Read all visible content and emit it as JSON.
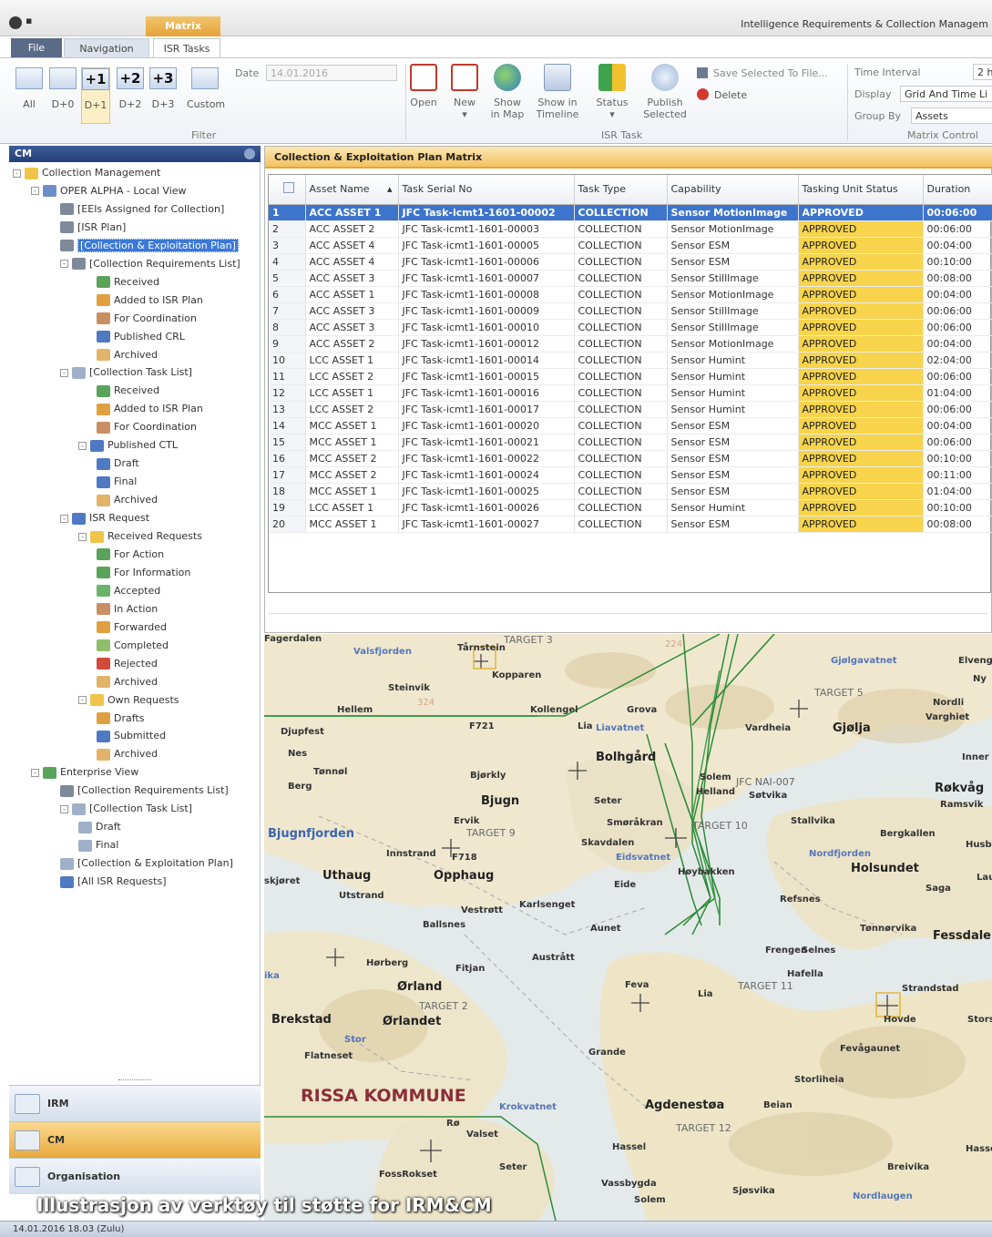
{
  "window": {
    "quick_access": "▪",
    "context_tab": "Matrix",
    "app_title": "Intelligence Requirements & Collection Managem"
  },
  "ribbon": {
    "tabs": [
      {
        "label": "File"
      },
      {
        "label": "Navigation"
      },
      {
        "label": "ISR Tasks"
      }
    ],
    "filter": {
      "group_label": "Filter",
      "buttons": [
        {
          "icon": "",
          "label": "All"
        },
        {
          "icon": "",
          "label": "D+0"
        },
        {
          "icon": "+1",
          "label": "D+1"
        },
        {
          "icon": "+2",
          "label": "D+2"
        },
        {
          "icon": "+3",
          "label": "D+3"
        },
        {
          "icon": "",
          "label": "Custom"
        }
      ],
      "date_label": "Date",
      "date_value": "14.01.2016"
    },
    "isr_task": {
      "group_label": "ISR Task",
      "buttons": [
        {
          "label": "Open",
          "label2": ""
        },
        {
          "label": "New",
          "label2": "▾"
        },
        {
          "label": "Show",
          "label2": "in Map"
        },
        {
          "label": "Show in",
          "label2": "Timeline"
        },
        {
          "label": "Status",
          "label2": "▾"
        },
        {
          "label": "Publish",
          "label2": "Selected"
        }
      ],
      "save_label": "Save Selected To File...",
      "delete_label": "Delete"
    },
    "matrix_control": {
      "group_label": "Matrix Control",
      "time_interval_label": "Time Interval",
      "time_interval_value": "2 h",
      "display_label": "Display",
      "display_value": "Grid And Time Li",
      "group_by_label": "Group By",
      "group_by_value": "Assets"
    }
  },
  "left_panel": {
    "title": "CM",
    "tree": [
      {
        "label": "Collection Management",
        "exp": "-",
        "color": "#f0c34a"
      },
      {
        "label": "OPER ALPHA - Local View",
        "exp": "-",
        "color": "#6d8fc9"
      },
      {
        "label": "[EEIs Assigned for Collection]",
        "exp": "",
        "color": "#7e8a9a"
      },
      {
        "label": "[ISR Plan]",
        "exp": "",
        "color": "#7e8a9a"
      },
      {
        "label": "[Collection & Exploitation Plan]",
        "exp": "",
        "color": "#7e8a9a"
      },
      {
        "label": "[Collection Requirements List]",
        "exp": "-",
        "color": "#7e8a9a"
      },
      {
        "label": "Received",
        "exp": "",
        "color": "#5aa35a"
      },
      {
        "label": "Added to ISR Plan",
        "exp": "",
        "color": "#e0a040"
      },
      {
        "label": "For Coordination",
        "exp": "",
        "color": "#c98f63"
      },
      {
        "label": "Published CRL",
        "exp": "",
        "color": "#4f79c2"
      },
      {
        "label": "Archived",
        "exp": "",
        "color": "#e3b36a"
      },
      {
        "label": "[Collection Task List]",
        "exp": "-",
        "color": "#9fb0c8"
      },
      {
        "label": "Received",
        "exp": "",
        "color": "#5aa35a"
      },
      {
        "label": "Added to ISR Plan",
        "exp": "",
        "color": "#e0a040"
      },
      {
        "label": "For Coordination",
        "exp": "",
        "color": "#c98f63"
      },
      {
        "label": "Published CTL",
        "exp": "-",
        "color": "#4f79c2"
      },
      {
        "label": "Draft",
        "exp": "",
        "color": "#4f79c2"
      },
      {
        "label": "Final",
        "exp": "",
        "color": "#4f79c2"
      },
      {
        "label": "Archived",
        "exp": "",
        "color": "#e3b36a"
      },
      {
        "label": "ISR Request",
        "exp": "-",
        "color": "#4f79c2"
      },
      {
        "label": "Received Requests",
        "exp": "-",
        "color": "#f0c34a"
      },
      {
        "label": "For Action",
        "exp": "",
        "color": "#5aa35a"
      },
      {
        "label": "For Information",
        "exp": "",
        "color": "#5aa35a"
      },
      {
        "label": "Accepted",
        "exp": "",
        "color": "#6bb36b"
      },
      {
        "label": "In Action",
        "exp": "",
        "color": "#c98f63"
      },
      {
        "label": "Forwarded",
        "exp": "",
        "color": "#e0a040"
      },
      {
        "label": "Completed",
        "exp": "",
        "color": "#8fbf6a"
      },
      {
        "label": "Rejected",
        "exp": "",
        "color": "#d24a3a"
      },
      {
        "label": "Archived",
        "exp": "",
        "color": "#e3b36a"
      },
      {
        "label": "Own Requests",
        "exp": "-",
        "color": "#f0c34a"
      },
      {
        "label": "Drafts",
        "exp": "",
        "color": "#e0a040"
      },
      {
        "label": "Submitted",
        "exp": "",
        "color": "#4f79c2"
      },
      {
        "label": "Archived",
        "exp": "",
        "color": "#e3b36a"
      },
      {
        "label": "Enterprise View",
        "exp": "-",
        "color": "#5aa35a"
      },
      {
        "label": "[Collection Requirements List]",
        "exp": "",
        "color": "#7e8a9a"
      },
      {
        "label": "[Collection Task List]",
        "exp": "-",
        "color": "#9fb0c8"
      },
      {
        "label": "Draft",
        "exp": "",
        "color": "#9fb0c8"
      },
      {
        "label": "Final",
        "exp": "",
        "color": "#9fb0c8"
      },
      {
        "label": "[Collection & Exploitation Plan]",
        "exp": "",
        "color": "#9fb0c8"
      },
      {
        "label": "[All ISR Requests]",
        "exp": "",
        "color": "#4f79c2"
      }
    ],
    "nav_buttons": [
      {
        "label": "IRM"
      },
      {
        "label": "CM"
      },
      {
        "label": "Organisation"
      }
    ]
  },
  "matrix": {
    "title": "Collection & Exploitation Plan Matrix",
    "columns": [
      "",
      "Asset Name",
      "Task Serial No",
      "Task Type",
      "Capability",
      "Tasking Unit Status",
      "Duration"
    ],
    "sort_glyph": "▴",
    "rows": [
      [
        "1",
        "ACC ASSET 1",
        "JFC Task-icmt1-1601-00002",
        "COLLECTION",
        "Sensor MotionImage",
        "APPROVED",
        "00:06:00"
      ],
      [
        "2",
        "ACC ASSET 2",
        "JFC Task-icmt1-1601-00003",
        "COLLECTION",
        "Sensor MotionImage",
        "APPROVED",
        "00:06:00"
      ],
      [
        "3",
        "ACC ASSET 4",
        "JFC Task-icmt1-1601-00005",
        "COLLECTION",
        "Sensor ESM",
        "APPROVED",
        "00:04:00"
      ],
      [
        "4",
        "ACC ASSET 4",
        "JFC Task-icmt1-1601-00006",
        "COLLECTION",
        "Sensor ESM",
        "APPROVED",
        "00:10:00"
      ],
      [
        "5",
        "ACC ASSET 3",
        "JFC Task-icmt1-1601-00007",
        "COLLECTION",
        "Sensor StillImage",
        "APPROVED",
        "00:08:00"
      ],
      [
        "6",
        "ACC ASSET 1",
        "JFC Task-icmt1-1601-00008",
        "COLLECTION",
        "Sensor MotionImage",
        "APPROVED",
        "00:04:00"
      ],
      [
        "7",
        "ACC ASSET 3",
        "JFC Task-icmt1-1601-00009",
        "COLLECTION",
        "Sensor StillImage",
        "APPROVED",
        "00:06:00"
      ],
      [
        "8",
        "ACC ASSET 3",
        "JFC Task-icmt1-1601-00010",
        "COLLECTION",
        "Sensor StillImage",
        "APPROVED",
        "00:06:00"
      ],
      [
        "9",
        "ACC ASSET 2",
        "JFC Task-icmt1-1601-00012",
        "COLLECTION",
        "Sensor MotionImage",
        "APPROVED",
        "00:04:00"
      ],
      [
        "10",
        "LCC ASSET 1",
        "JFC Task-icmt1-1601-00014",
        "COLLECTION",
        "Sensor Humint",
        "APPROVED",
        "02:04:00"
      ],
      [
        "11",
        "LCC ASSET 2",
        "JFC Task-icmt1-1601-00015",
        "COLLECTION",
        "Sensor Humint",
        "APPROVED",
        "00:06:00"
      ],
      [
        "12",
        "LCC ASSET 1",
        "JFC Task-icmt1-1601-00016",
        "COLLECTION",
        "Sensor Humint",
        "APPROVED",
        "01:04:00"
      ],
      [
        "13",
        "LCC ASSET 2",
        "JFC Task-icmt1-1601-00017",
        "COLLECTION",
        "Sensor Humint",
        "APPROVED",
        "00:06:00"
      ],
      [
        "14",
        "MCC ASSET 1",
        "JFC Task-icmt1-1601-00020",
        "COLLECTION",
        "Sensor ESM",
        "APPROVED",
        "00:04:00"
      ],
      [
        "15",
        "MCC ASSET 1",
        "JFC Task-icmt1-1601-00021",
        "COLLECTION",
        "Sensor ESM",
        "APPROVED",
        "00:06:00"
      ],
      [
        "16",
        "MCC ASSET 2",
        "JFC Task-icmt1-1601-00022",
        "COLLECTION",
        "Sensor ESM",
        "APPROVED",
        "00:10:00"
      ],
      [
        "17",
        "MCC ASSET 2",
        "JFC Task-icmt1-1601-00024",
        "COLLECTION",
        "Sensor ESM",
        "APPROVED",
        "00:11:00"
      ],
      [
        "18",
        "MCC ASSET 1",
        "JFC Task-icmt1-1601-00025",
        "COLLECTION",
        "Sensor ESM",
        "APPROVED",
        "01:04:00"
      ],
      [
        "19",
        "LCC ASSET 1",
        "JFC Task-icmt1-1601-00026",
        "COLLECTION",
        "Sensor Humint",
        "APPROVED",
        "00:10:00"
      ],
      [
        "20",
        "MCC ASSET 1",
        "JFC Task-icmt1-1601-00027",
        "COLLECTION",
        "Sensor ESM",
        "APPROVED",
        "00:08:00"
      ]
    ]
  },
  "map": {
    "labels": [
      {
        "text": "Valsfjorden",
        "cls": "blue sm"
      },
      {
        "text": "Tårnstein",
        "cls": "sm"
      },
      {
        "text": "TARGET 3",
        "cls": "target"
      },
      {
        "text": "Kopparen",
        "cls": "sm"
      },
      {
        "text": "224",
        "cls": "num"
      },
      {
        "text": "Gjølgavatnet",
        "cls": "blue sm"
      },
      {
        "text": "Elveng",
        "cls": "sm"
      },
      {
        "text": "Ny",
        "cls": "sm"
      },
      {
        "text": "Steinvik",
        "cls": "sm"
      },
      {
        "text": "324",
        "cls": "num"
      },
      {
        "text": "Hellem",
        "cls": "sm"
      },
      {
        "text": "Kollengel",
        "cls": "sm"
      },
      {
        "text": "Grova",
        "cls": "sm"
      },
      {
        "text": "TARGET 5",
        "cls": "target"
      },
      {
        "text": "Nordli",
        "cls": "sm"
      },
      {
        "text": "Varghiet",
        "cls": "sm"
      },
      {
        "text": "Djupfest",
        "cls": "sm"
      },
      {
        "text": "F721",
        "cls": "sm"
      },
      {
        "text": "Lia",
        "cls": "sm"
      },
      {
        "text": "Liavatnet",
        "cls": "blue sm"
      },
      {
        "text": "Vardheia",
        "cls": "sm"
      },
      {
        "text": "Gjølja",
        "cls": "big"
      },
      {
        "text": "Nes",
        "cls": "sm"
      },
      {
        "text": "Bolhgård",
        "cls": "big"
      },
      {
        "text": "Inner",
        "cls": "sm"
      },
      {
        "text": "Tønnøl",
        "cls": "sm"
      },
      {
        "text": "Bjørkly",
        "cls": "sm"
      },
      {
        "text": "Solem",
        "cls": "sm"
      },
      {
        "text": "Helland",
        "cls": "sm"
      },
      {
        "text": "JFC NAI-007",
        "cls": "nai"
      },
      {
        "text": "Søtvika",
        "cls": "sm"
      },
      {
        "text": "Berg",
        "cls": "sm"
      },
      {
        "text": "Bjugn",
        "cls": "big"
      },
      {
        "text": "Seter",
        "cls": "sm"
      },
      {
        "text": "Røkvåg",
        "cls": "big"
      },
      {
        "text": "Ramsvik",
        "cls": "sm"
      },
      {
        "text": "Ervik",
        "cls": "sm"
      },
      {
        "text": "Smøråkran",
        "cls": "sm"
      },
      {
        "text": "TARGET 10",
        "cls": "target"
      },
      {
        "text": "Stallvika",
        "cls": "sm"
      },
      {
        "text": "Bjugnfjorden",
        "cls": "water"
      },
      {
        "text": "TARGET 9",
        "cls": "target"
      },
      {
        "text": "Skavdalen",
        "cls": "sm"
      },
      {
        "text": "Bergkallen",
        "cls": "sm"
      },
      {
        "text": "Husb",
        "cls": "sm"
      },
      {
        "text": "Innstrand",
        "cls": "sm"
      },
      {
        "text": "F718",
        "cls": "sm"
      },
      {
        "text": "Eidsvatnet",
        "cls": "blue sm"
      },
      {
        "text": "Nordfjorden",
        "cls": "blue sm"
      },
      {
        "text": "Holsundet",
        "cls": "big"
      },
      {
        "text": "Lauvlin",
        "cls": "sm"
      },
      {
        "text": "skjøret",
        "cls": "sm"
      },
      {
        "text": "Uthaug",
        "cls": "big"
      },
      {
        "text": "Opphaug",
        "cls": "big"
      },
      {
        "text": "Høybakken",
        "cls": "sm"
      },
      {
        "text": "Eide",
        "cls": "sm"
      },
      {
        "text": "Saga",
        "cls": "sm"
      },
      {
        "text": "Utstrand",
        "cls": "sm"
      },
      {
        "text": "Refsnes",
        "cls": "sm"
      },
      {
        "text": "Karlsenget",
        "cls": "sm"
      },
      {
        "text": "Vestrøtt",
        "cls": "sm"
      },
      {
        "text": "Ballsnes",
        "cls": "sm"
      },
      {
        "text": "Aunet",
        "cls": "sm"
      },
      {
        "text": "Tønnørvika",
        "cls": "sm"
      },
      {
        "text": "Fessdalen",
        "cls": "big"
      },
      {
        "text": "Frengen",
        "cls": "sm"
      },
      {
        "text": "Selnes",
        "cls": "sm"
      },
      {
        "text": "Austrått",
        "cls": "sm"
      },
      {
        "text": "Hørberg",
        "cls": "sm"
      },
      {
        "text": "Fitjan",
        "cls": "sm"
      },
      {
        "text": "Hafella",
        "cls": "sm"
      },
      {
        "text": "ika",
        "cls": "blue sm"
      },
      {
        "text": "Ørland",
        "cls": "big"
      },
      {
        "text": "Feva",
        "cls": "sm"
      },
      {
        "text": "TARGET 11",
        "cls": "target"
      },
      {
        "text": "Lia",
        "cls": "sm"
      },
      {
        "text": "Strandstad",
        "cls": "sm"
      },
      {
        "text": "TARGET 2",
        "cls": "target"
      },
      {
        "text": "Brekstad",
        "cls": "big"
      },
      {
        "text": "Ørlandet",
        "cls": "big"
      },
      {
        "text": "Hovde",
        "cls": "sm"
      },
      {
        "text": "Storsalen",
        "cls": "sm"
      },
      {
        "text": "Stor",
        "cls": "blue sm"
      },
      {
        "text": "Flatneset",
        "cls": "sm"
      },
      {
        "text": "Grande",
        "cls": "sm"
      },
      {
        "text": "Fevågaunet",
        "cls": "sm"
      },
      {
        "text": "Storliheia",
        "cls": "sm"
      },
      {
        "text": "RISSA KOMMUNE",
        "cls": "kommune"
      },
      {
        "text": "Beian",
        "cls": "sm"
      },
      {
        "text": "Krokvatnet",
        "cls": "blue sm"
      },
      {
        "text": "Agdenestøa",
        "cls": "big"
      },
      {
        "text": "Rø",
        "cls": "sm"
      },
      {
        "text": "Valset",
        "cls": "sm"
      },
      {
        "text": "TARGET 12",
        "cls": "target"
      },
      {
        "text": "Hassel",
        "cls": "sm"
      },
      {
        "text": "Hasselvika",
        "cls": "sm"
      },
      {
        "text": "Seter",
        "cls": "sm"
      },
      {
        "text": "Breivika",
        "cls": "sm"
      },
      {
        "text": "FossRokset",
        "cls": "sm"
      },
      {
        "text": "Vassbygda",
        "cls": "sm"
      },
      {
        "text": "Sjøsvika",
        "cls": "sm"
      },
      {
        "text": "Nordlaugen",
        "cls": "blue sm"
      },
      {
        "text": "Solem",
        "cls": "sm"
      },
      {
        "text": "Fagerdalen",
        "cls": "sm"
      }
    ]
  },
  "caption": "Illustrasjon av verktøy til støtte for IRM&CM",
  "status_bar": "14.01.2016 18.03 (Zulu)"
}
